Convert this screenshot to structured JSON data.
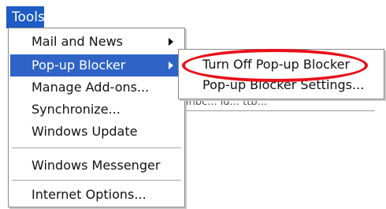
{
  "menu_bar": {
    "title": "Tools"
  },
  "menu": {
    "items": [
      {
        "label": "Mail and News",
        "has_submenu": true
      },
      {
        "label": "Pop-up Blocker",
        "has_submenu": true,
        "selected": true
      },
      {
        "label": "Manage Add-ons..."
      },
      {
        "label": "Synchronize..."
      },
      {
        "label": "Windows Update"
      },
      {
        "label": "Windows Messenger"
      },
      {
        "label": "Internet Options..."
      }
    ]
  },
  "submenu": {
    "items": [
      {
        "label": "Turn Off Pop-up Blocker",
        "highlighted": true
      },
      {
        "label": "Pop-up Blocker Settings..."
      }
    ]
  },
  "colors": {
    "selection": "#2f63c6",
    "highlight_ring": "#e8101a"
  }
}
